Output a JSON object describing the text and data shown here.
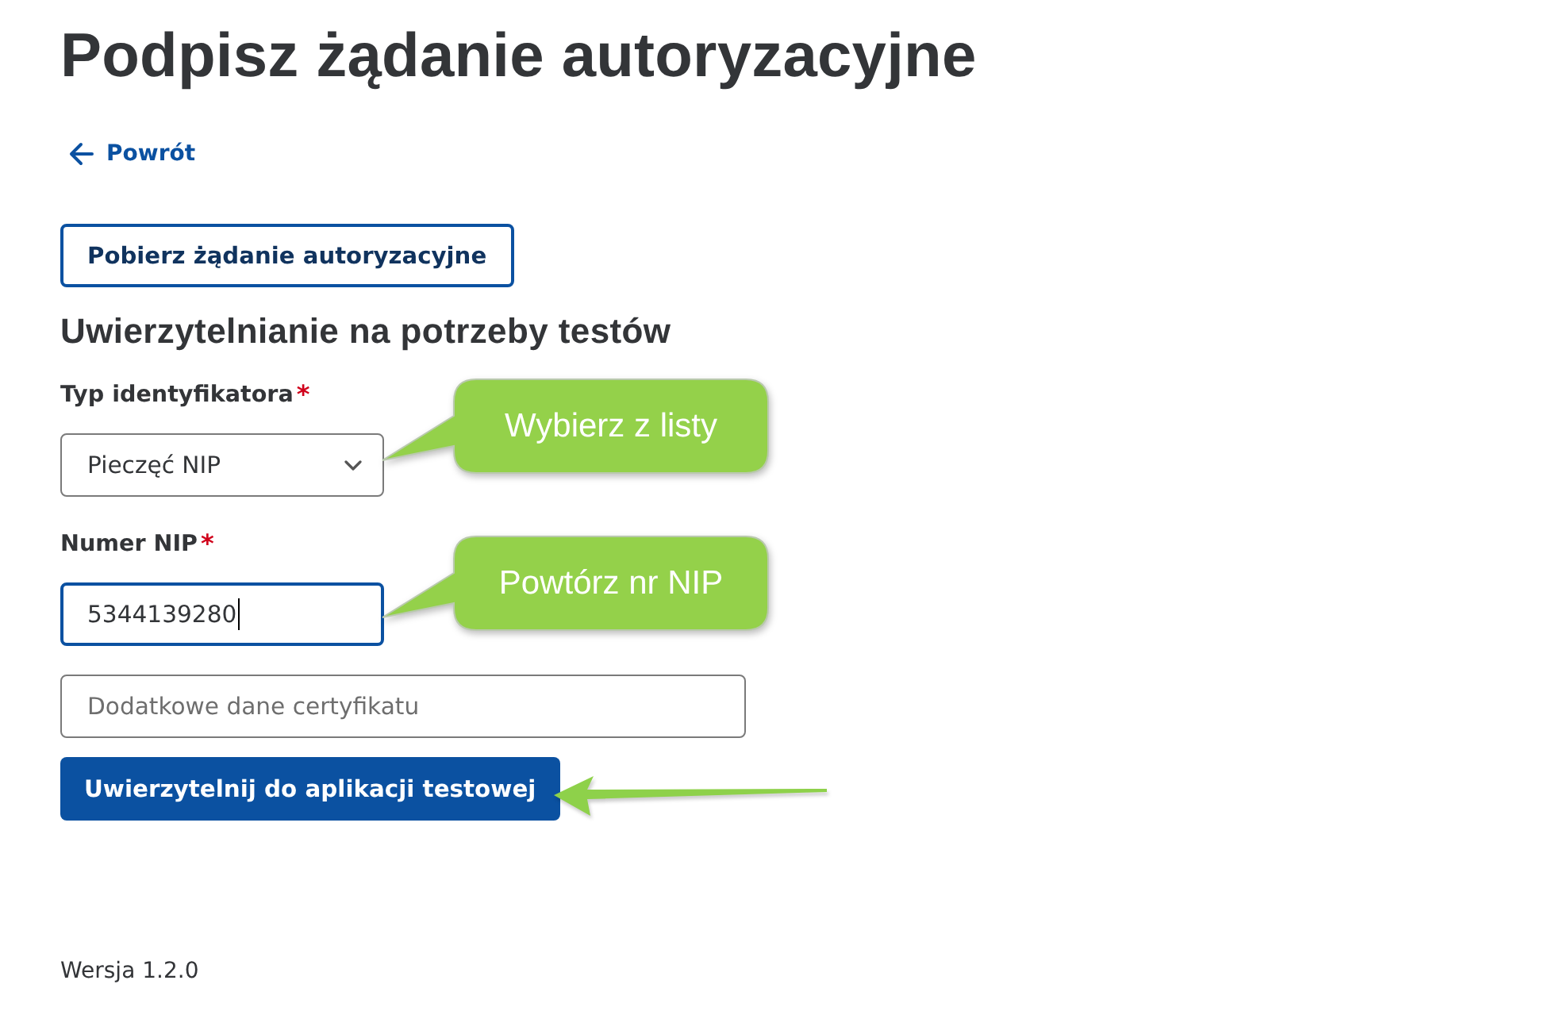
{
  "page": {
    "title": "Podpisz żądanie autoryzacyjne"
  },
  "back_link": {
    "label": "Powrót"
  },
  "download_button": {
    "label": "Pobierz żądanie autoryzacyjne"
  },
  "section": {
    "heading": "Uwierzytelnianie na potrzeby testów",
    "fields": [
      {
        "kind": "select",
        "label": "Typ identyfikatora",
        "required_mark": "*",
        "value": "Pieczęć NIP",
        "focused": false,
        "callout": "Wybierz z listy"
      },
      {
        "kind": "text",
        "label": "Numer NIP",
        "required_mark": "*",
        "value": "5344139280",
        "focused": true,
        "callout": "Powtórz nr NIP"
      },
      {
        "kind": "text",
        "placeholder": "Dodatkowe dane certyfikatu",
        "focused": false
      }
    ],
    "submit_button": {
      "label": "Uwierzytelnij do aplikacji testowej",
      "annotation_arrow": true
    }
  },
  "footer": {
    "version": "Wersja 1.2.0"
  }
}
